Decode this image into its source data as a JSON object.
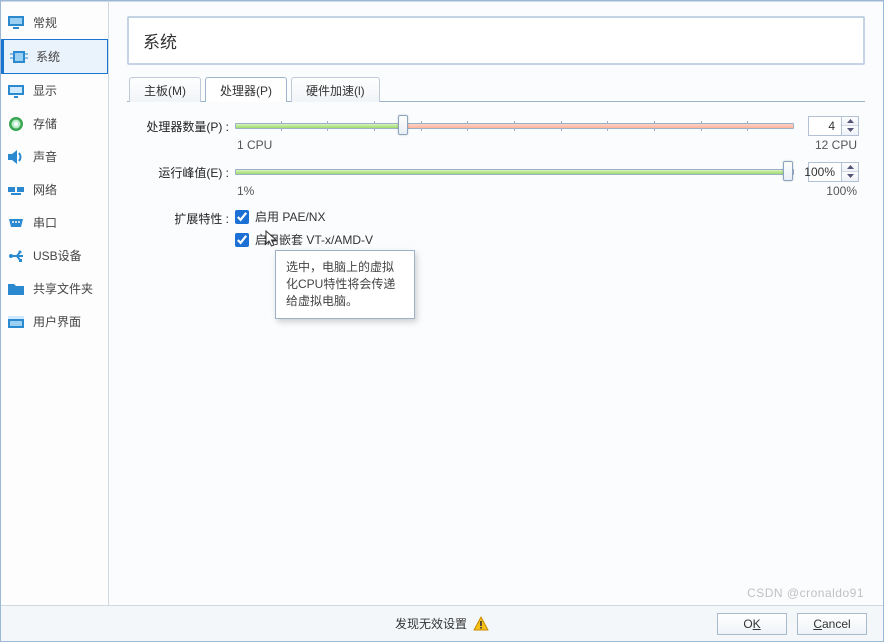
{
  "sidebar": {
    "items": [
      {
        "label": "常规",
        "icon": "monitor-icon",
        "color": "#2a89cf"
      },
      {
        "label": "系统",
        "icon": "chip-icon",
        "color": "#2a89cf",
        "selected": true
      },
      {
        "label": "显示",
        "icon": "display-icon",
        "color": "#2a89cf"
      },
      {
        "label": "存储",
        "icon": "disc-icon",
        "color": "#2a89cf"
      },
      {
        "label": "声音",
        "icon": "speaker-icon",
        "color": "#2a89cf"
      },
      {
        "label": "网络",
        "icon": "network-icon",
        "color": "#2a89cf"
      },
      {
        "label": "串口",
        "icon": "serial-icon",
        "color": "#2a89cf"
      },
      {
        "label": "USB设备",
        "icon": "usb-icon",
        "color": "#2a89cf"
      },
      {
        "label": "共享文件夹",
        "icon": "folder-icon",
        "color": "#2a89cf"
      },
      {
        "label": "用户界面",
        "icon": "window-icon",
        "color": "#2a89cf"
      }
    ]
  },
  "header": {
    "title": "系统"
  },
  "tabs": [
    {
      "label": "主板(M)",
      "key": "motherboard"
    },
    {
      "label": "处理器(P)",
      "key": "processor",
      "active": true
    },
    {
      "label": "硬件加速(l)",
      "key": "accel"
    }
  ],
  "processor": {
    "cpu_count_label": "处理器数量(P)",
    "cpu_min_label": "1 CPU",
    "cpu_max_label": "12 CPU",
    "cpu_value": "4",
    "cpu_green_pct": 30,
    "cpu_thumb_pct": 30,
    "cap_label": "运行峰值(E)",
    "cap_min_label": "1%",
    "cap_max_label": "100%",
    "cap_value": "100%",
    "cap_green_pct": 100,
    "cap_thumb_pct": 99,
    "ext_label": "扩展特性",
    "chk_pae_label": "启用 PAE/NX",
    "chk_pae_checked": true,
    "chk_vtx_label": "启用嵌套 VT-x/AMD-V",
    "chk_vtx_checked": true
  },
  "tooltip": {
    "text": "选中，电脑上的虚拟化CPU特性将会传递给虚拟电脑。"
  },
  "footer": {
    "status_text": "发现无效设置",
    "ok_label_pre": "O",
    "ok_label_key": "K",
    "cancel_label_pre": "",
    "cancel_label_key": "C",
    "cancel_label_post": "ancel"
  },
  "watermark": "CSDN @cronaldo91"
}
